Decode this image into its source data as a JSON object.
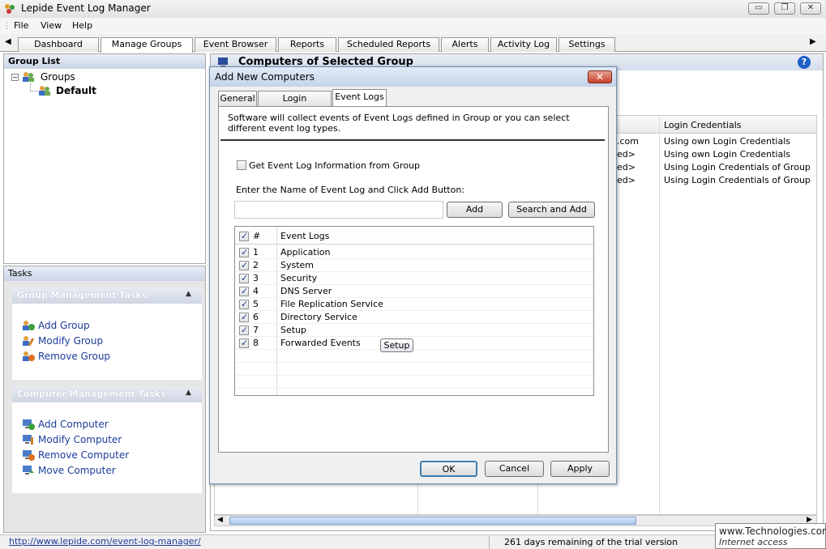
{
  "window": {
    "title": "Lepide Event Log Manager",
    "min": "▭",
    "max": "❐",
    "close": "✕"
  },
  "menu": [
    "File",
    "View",
    "Help"
  ],
  "tabs": [
    {
      "label": "Dashboard"
    },
    {
      "label": "Manage Groups",
      "selected": true
    },
    {
      "label": "Event Browser"
    },
    {
      "label": "Reports"
    },
    {
      "label": "Scheduled Reports"
    },
    {
      "label": "Alerts"
    },
    {
      "label": "Activity Log"
    },
    {
      "label": "Settings"
    }
  ],
  "group_list": {
    "title": "Group List",
    "root": "Groups",
    "child": "Default"
  },
  "tasks": {
    "title": "Tasks",
    "group_section": {
      "title": "Group Management Tasks",
      "items": [
        "Add Group",
        "Modify Group",
        "Remove Group"
      ]
    },
    "computer_section": {
      "title": "Computer Management Tasks",
      "items": [
        "Add Computer",
        "Modify Computer",
        "Remove Computer",
        "Move Computer"
      ]
    }
  },
  "right_panel": {
    "title": "Computers of Selected Group",
    "column_login": "Login Credentials",
    "rows": [
      {
        "name_tail": ".com",
        "login": "Using own Login Credentials"
      },
      {
        "name_tail": "ed>",
        "login": "Using own Login Credentials"
      },
      {
        "name_tail": "ed>",
        "login": "Using Login Credentials of Group"
      },
      {
        "name_tail": "ed>",
        "login": "Using Login Credentials of Group"
      }
    ]
  },
  "dialog": {
    "title": "Add New Computers",
    "tabs": [
      "General",
      "Login Credentials",
      "Event Logs"
    ],
    "description": "Software will collect events of Event Logs defined in Group or you can select different event log types.",
    "get_from_group_label": "Get Event Log Information from Group",
    "enter_name_label": "Enter the Name of Event Log and Click Add Button:",
    "input_value": "",
    "add_button": "Add",
    "search_add_button": "Search and Add",
    "grid_headers": {
      "num": "#",
      "name": "Event Logs"
    },
    "logs": [
      {
        "num": "1",
        "name": "Application",
        "checked": true
      },
      {
        "num": "2",
        "name": "System",
        "checked": true
      },
      {
        "num": "3",
        "name": "Security",
        "checked": true
      },
      {
        "num": "4",
        "name": "DNS Server",
        "checked": true
      },
      {
        "num": "5",
        "name": "File Replication Service",
        "checked": true
      },
      {
        "num": "6",
        "name": "Directory Service",
        "checked": true
      },
      {
        "num": "7",
        "name": "Setup",
        "checked": true
      },
      {
        "num": "8",
        "name": "Forwarded Events",
        "checked": true
      }
    ],
    "tooltip": "Setup",
    "ok": "OK",
    "cancel": "Cancel",
    "apply": "Apply"
  },
  "status": {
    "link": "http://www.lepide.com/event-log-manager/",
    "trial": "261 days remaining of the trial version",
    "watermark1": "www.Technologies.com",
    "watermark2": "Internet access"
  },
  "colors": {
    "link": "#1b3c9a",
    "accent": "#c3d3e8"
  }
}
